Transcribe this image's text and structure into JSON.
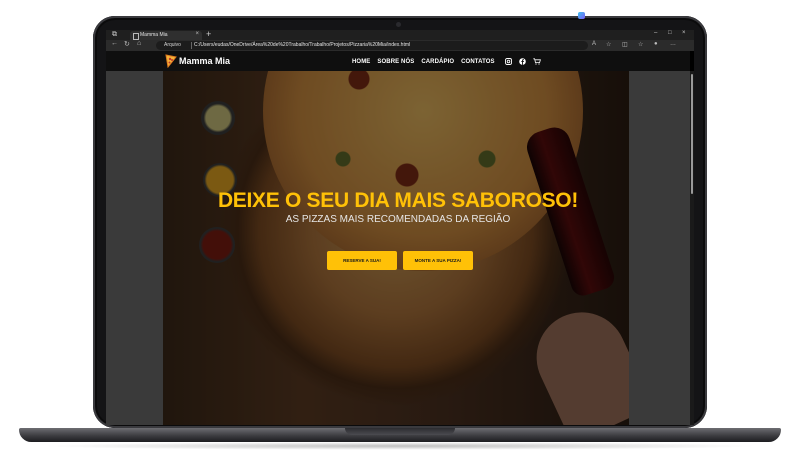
{
  "browser": {
    "tab_title": "Mamma Mia",
    "tab_close": "×",
    "new_tab": "+",
    "address_label": "Arquivo",
    "url": "C:/Users/eudas/OneDrive/Área%20de%20Trabalho/Trabalho/Projetos/Pizzaria%20Mia/index.html",
    "window_controls": [
      "–",
      "□",
      "×"
    ]
  },
  "site": {
    "logo_text": "Mamma Mia",
    "menu": [
      "HOME",
      "SOBRE NÓS",
      "CARDÁPIO",
      "CONTATOS"
    ],
    "social_icons": [
      "instagram-icon",
      "facebook-icon",
      "cart-icon"
    ],
    "hero": {
      "title": "DEIXE O SEU DIA MAIS SABOROSO!",
      "subtitle": "AS PIZZAS MAIS RECOMENDADAS DA REGIÃO",
      "button_reserve": "RESERVE A SUA!",
      "button_build": "MONTE A SUA PIZZA!"
    },
    "colors": {
      "accent": "#ffc107",
      "nav_bg": "#0f0f0f"
    }
  }
}
